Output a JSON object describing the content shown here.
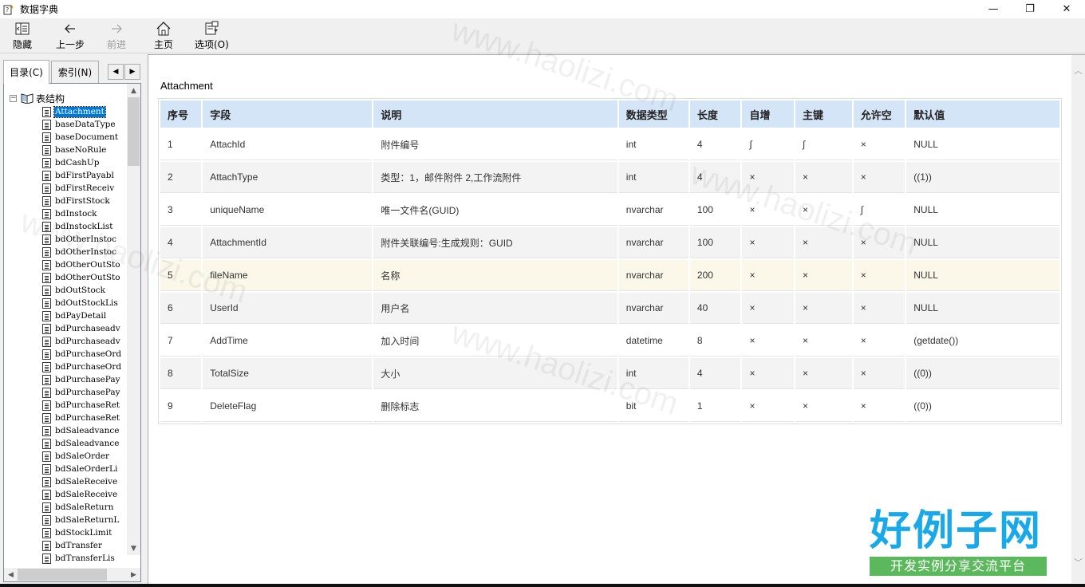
{
  "window": {
    "title": "数据字典",
    "minimize": "—",
    "maximize": "❐",
    "close": "✕"
  },
  "toolbar": {
    "hide_label": "隐藏",
    "back_label": "上一步",
    "forward_label": "前进",
    "home_label": "主页",
    "options_label": "选项(O)"
  },
  "nav": {
    "tab_contents": "目录(C)",
    "tab_index": "索引(N)",
    "root_label": "表结构",
    "items": [
      "Attachment",
      "baseDataType",
      "baseDocument",
      "baseNoRule",
      "bdCashUp",
      "bdFirstPayabl",
      "bdFirstReceiv",
      "bdFirstStock",
      "bdInstock",
      "bdInstockList",
      "bdOtherInstoc",
      "bdOtherInstoc",
      "bdOtherOutSto",
      "bdOtherOutSto",
      "bdOutStock",
      "bdOutStockLis",
      "bdPayDetail",
      "bdPurchaseadv",
      "bdPurchaseadv",
      "bdPurchaseOrd",
      "bdPurchaseOrd",
      "bdPurchasePay",
      "bdPurchasePay",
      "bdPurchaseRet",
      "bdPurchaseRet",
      "bdSaleadvance",
      "bdSaleadvance",
      "bdSaleOrder",
      "bdSaleOrderLi",
      "bdSaleReceive",
      "bdSaleReceive",
      "bdSaleReturn",
      "bdSaleReturnL",
      "bdStockLimit",
      "bdTransfer",
      "bdTransferLis"
    ],
    "selected": "Attachment"
  },
  "content": {
    "title": "Attachment",
    "columns": [
      "序号",
      "字段",
      "说明",
      "数据类型",
      "长度",
      "自增",
      "主键",
      "允许空",
      "默认值"
    ],
    "rows": [
      [
        "1",
        "AttachId",
        "附件编号",
        "int",
        "4",
        "∫",
        "∫",
        "×",
        "NULL"
      ],
      [
        "2",
        "AttachType",
        "类型：1，邮件附件 2,工作流附件",
        "int",
        "4",
        "×",
        "×",
        "×",
        "((1))"
      ],
      [
        "3",
        "uniqueName",
        "唯一文件名(GUID)",
        "nvarchar",
        "100",
        "×",
        "×",
        "∫",
        "NULL"
      ],
      [
        "4",
        "AttachmentId",
        "附件关联编号:生成规则：GUID",
        "nvarchar",
        "100",
        "×",
        "×",
        "×",
        "NULL"
      ],
      [
        "5",
        "fileName",
        "名称",
        "nvarchar",
        "200",
        "×",
        "×",
        "×",
        "NULL"
      ],
      [
        "6",
        "UserId",
        "用户名",
        "nvarchar",
        "40",
        "×",
        "×",
        "×",
        "NULL"
      ],
      [
        "7",
        "AddTime",
        "加入时间",
        "datetime",
        "8",
        "×",
        "×",
        "×",
        "(getdate())"
      ],
      [
        "8",
        "TotalSize",
        "大小",
        "int",
        "4",
        "×",
        "×",
        "×",
        "((0))"
      ],
      [
        "9",
        "DeleteFlag",
        "删除标志",
        "bit",
        "1",
        "×",
        "×",
        "×",
        "((0))"
      ]
    ],
    "highlighted_row": 5
  },
  "watermark": {
    "text": "www.haolizi.com",
    "logo_big": "好例子网",
    "logo_small": "开发实例分享交流平台"
  },
  "colors": {
    "header_bg": "#d4e5f7",
    "selection": "#0078d7",
    "highlight_row": "#fbf7e9",
    "logo_blue": "#1aa9e8",
    "logo_green": "#5cb85c"
  }
}
